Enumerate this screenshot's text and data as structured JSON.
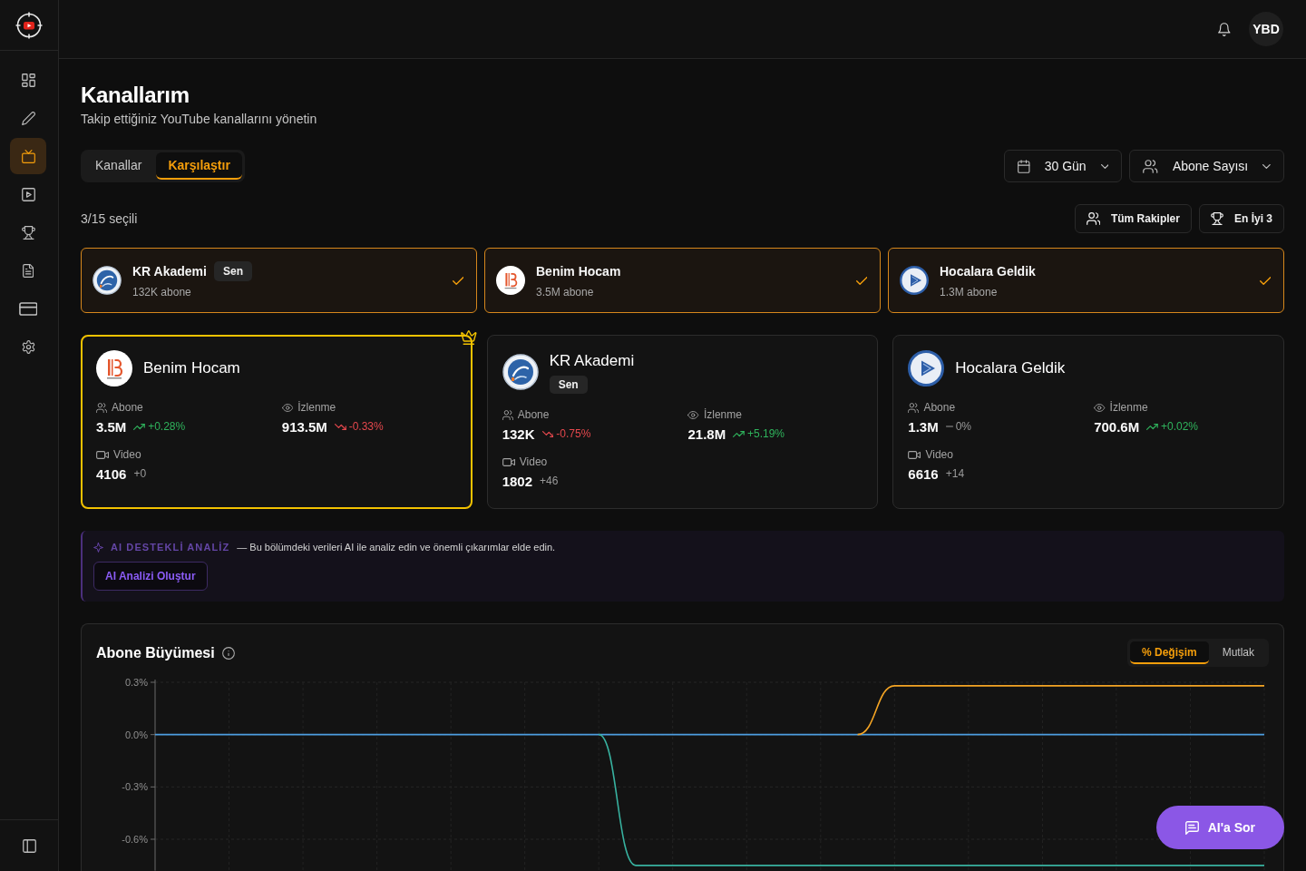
{
  "sidebar": {
    "items": [
      {
        "kind": "dashboard",
        "selected": false
      },
      {
        "kind": "editor",
        "selected": false
      },
      {
        "kind": "channels",
        "selected": true
      },
      {
        "kind": "videos",
        "selected": false
      },
      {
        "kind": "rankings",
        "selected": false
      },
      {
        "kind": "reports",
        "selected": false
      },
      {
        "kind": "billing",
        "selected": false
      },
      {
        "kind": "settings",
        "selected": false
      }
    ]
  },
  "topbar": {
    "avatar": "YBD"
  },
  "header": {
    "title": "Kanallarım",
    "subtitle": "Takip ettiğiniz YouTube kanallarını yönetin"
  },
  "tabs": [
    {
      "label": "Kanallar",
      "selected": false
    },
    {
      "label": "Karşılaştır",
      "selected": true
    }
  ],
  "filters": [
    {
      "kind": "period",
      "label": "30 Gün"
    },
    {
      "kind": "metric",
      "label": "Abone Sayısı"
    }
  ],
  "selection": {
    "count": "3/15 seçili",
    "buttons": [
      {
        "kind": "rivals",
        "label": "Tüm Rakipler"
      },
      {
        "kind": "top",
        "label": "En İyi 3"
      }
    ]
  },
  "selected_channels": [
    {
      "kind": "emblem",
      "name": "KR Akademi",
      "badge": "Sen",
      "subscribers": "132K abone",
      "selected": true
    },
    {
      "kind": "stripes",
      "name": "Benim Hocam",
      "subscribers": "3.5M abone",
      "selected": true
    },
    {
      "kind": "play",
      "name": "Hocalara Geldik",
      "subscribers": "1.3M abone",
      "selected": true
    }
  ],
  "compare_cards": [
    {
      "kind": "stripes",
      "name": "Benim Hocam",
      "leader": true,
      "stats": [
        {
          "kind": "subscribers",
          "label": "Abone",
          "value": "3.5M",
          "change": {
            "kind": "up",
            "label": "+0.28%"
          }
        },
        {
          "kind": "views",
          "label": "İzlenme",
          "value": "913.5M",
          "change": {
            "kind": "down",
            "label": "-0.33%"
          }
        },
        {
          "kind": "videos",
          "label": "Video",
          "value": "4106",
          "change": {
            "kind": "plain",
            "label": "+0"
          }
        }
      ]
    },
    {
      "kind": "emblem",
      "name": "KR Akademi",
      "badge": "Sen",
      "leader": false,
      "stats": [
        {
          "kind": "subscribers",
          "label": "Abone",
          "value": "132K",
          "change": {
            "kind": "down",
            "label": "-0.75%"
          }
        },
        {
          "kind": "views",
          "label": "İzlenme",
          "value": "21.8M",
          "change": {
            "kind": "up",
            "label": "+5.19%"
          }
        },
        {
          "kind": "videos",
          "label": "Video",
          "value": "1802",
          "change": {
            "kind": "plain",
            "label": "+46"
          }
        }
      ]
    },
    {
      "kind": "play",
      "name": "Hocalara Geldik",
      "leader": false,
      "stats": [
        {
          "kind": "subscribers",
          "label": "Abone",
          "value": "1.3M",
          "change": {
            "kind": "flat",
            "label": "0%"
          }
        },
        {
          "kind": "views",
          "label": "İzlenme",
          "value": "700.6M",
          "change": {
            "kind": "up",
            "label": "+0.02%"
          }
        },
        {
          "kind": "videos",
          "label": "Video",
          "value": "6616",
          "change": {
            "kind": "plain",
            "label": "+14"
          }
        }
      ]
    }
  ],
  "ai_analysis": {
    "title": "AI DESTEKLİ ANALİZ",
    "description": "— Bu bölümdeki verileri AI ile analiz edin ve önemli çıkarımlar elde edin.",
    "button": "AI Analizi Oluştur"
  },
  "growth_chart": {
    "title": "Abone Büyümesi",
    "modes": [
      {
        "label": "% Değişim",
        "selected": true
      },
      {
        "label": "Mutlak",
        "selected": false
      }
    ],
    "chart_data": {
      "type": "line",
      "categories": [
        null,
        null,
        null,
        null,
        null,
        null,
        null,
        null,
        null,
        null,
        null,
        null,
        null,
        null,
        null,
        null,
        null,
        null,
        null,
        null,
        null,
        null,
        null,
        null,
        null,
        null,
        null,
        null,
        null,
        null,
        null
      ],
      "ylim": [
        -0.78,
        0.3
      ],
      "yticks": [
        {
          "value": 0.3,
          "label": "0.3%"
        },
        {
          "value": 0,
          "label": "0.0%"
        },
        {
          "value": -0.3,
          "label": "-0.3%"
        },
        {
          "value": -0.6,
          "label": "-0.6%"
        }
      ],
      "grid": true,
      "series": [
        {
          "color": "#4d9de0",
          "values": [
            0,
            0,
            0,
            0,
            0,
            0,
            0,
            0,
            0,
            0,
            0,
            0,
            0,
            0,
            0,
            0,
            0,
            0,
            0,
            0,
            0,
            0,
            0,
            0,
            0,
            0,
            0,
            0,
            0,
            0,
            0
          ]
        },
        {
          "color": "#38b2a0",
          "values": [
            null,
            null,
            null,
            null,
            null,
            null,
            null,
            null,
            null,
            null,
            null,
            null,
            0,
            -0.75,
            -0.75,
            -0.75,
            -0.75,
            -0.75,
            -0.75,
            -0.75,
            -0.75,
            -0.75,
            -0.75,
            -0.75,
            -0.75,
            -0.75,
            -0.75,
            -0.75,
            -0.75,
            -0.75,
            -0.75
          ]
        },
        {
          "color": "#f5a524",
          "values": [
            null,
            null,
            null,
            null,
            null,
            null,
            null,
            null,
            null,
            null,
            null,
            null,
            null,
            null,
            null,
            null,
            null,
            null,
            null,
            0,
            0.28,
            0.28,
            0.28,
            0.28,
            0.28,
            0.28,
            0.28,
            0.28,
            0.28,
            0.28,
            0.28
          ]
        }
      ]
    }
  },
  "ask_ai": {
    "label": "AI'a Sor"
  }
}
